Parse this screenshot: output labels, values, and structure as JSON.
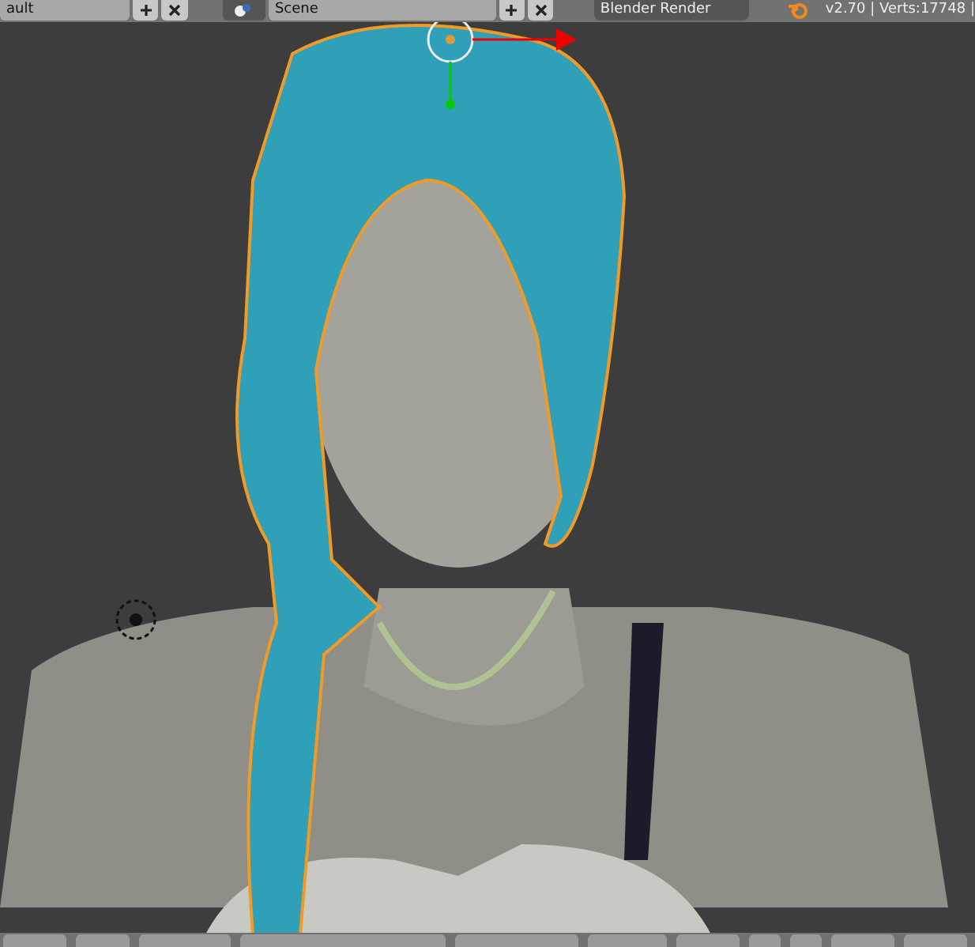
{
  "header": {
    "layout_field": "ault",
    "scene_field": "Scene",
    "render_engine": "Blender Render",
    "stats": "v2.70 | Verts:17748 |"
  },
  "viewport": {
    "kind": "scene"
  }
}
